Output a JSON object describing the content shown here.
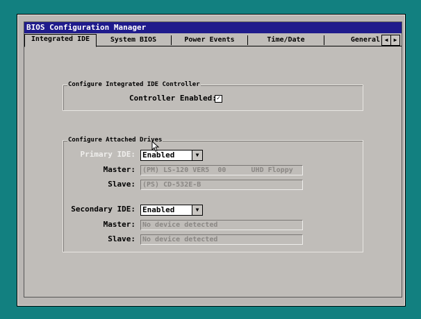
{
  "window": {
    "title": "BIOS Configuration Manager"
  },
  "tabs": [
    {
      "label": "Integrated IDE",
      "active": true
    },
    {
      "label": "System BIOS"
    },
    {
      "label": "Power Events"
    },
    {
      "label": "Time/Date"
    },
    {
      "label": "General"
    }
  ],
  "scroll": {
    "left": "◀",
    "right": "▶"
  },
  "controller_group": {
    "legend": "Configure Integrated IDE Controller",
    "enabled_label": "Controller Enabled:",
    "enabled_checked": true,
    "check_glyph": "✓"
  },
  "drives_group": {
    "legend": "Configure Attached Drives",
    "primary": {
      "label": "Primary IDE:",
      "value": "Enabled",
      "master_label": "Master:",
      "master_value": "(PM) LS-120 VER5  00      UHD Floppy",
      "slave_label": "Slave:",
      "slave_value": "(PS) CD-532E-B"
    },
    "secondary": {
      "label": "Secondary IDE:",
      "value": "Enabled",
      "master_label": "Master:",
      "master_value": "No device detected",
      "slave_label": "Slave:",
      "slave_value": "No device detected"
    }
  },
  "select_arrow": "▼",
  "colors": {
    "desktop": "#128080",
    "titlebar": "#1f1b8c",
    "panel": "#c0bdb9"
  }
}
